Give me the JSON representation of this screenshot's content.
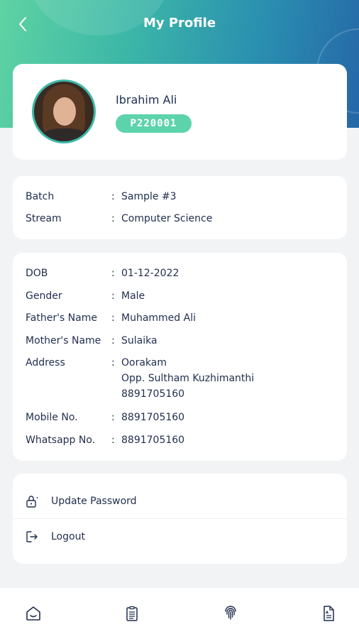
{
  "header": {
    "title": "My Profile"
  },
  "profile": {
    "name": "Ibrahim Ali",
    "id": "P220001"
  },
  "academic": [
    {
      "label": "Batch",
      "value": "Sample #3"
    },
    {
      "label": "Stream",
      "value": "Computer Science"
    }
  ],
  "personal": {
    "dob": {
      "label": "DOB",
      "value": "01-12-2022"
    },
    "gender": {
      "label": "Gender",
      "value": "Male"
    },
    "father": {
      "label": "Father's Name",
      "value": "Muhammed Ali"
    },
    "mother": {
      "label": "Mother's Name",
      "value": "Sulaika"
    },
    "address": {
      "label": "Address",
      "lines": [
        "Oorakam",
        "Opp. Sultham Kuzhimanthi",
        "8891705160"
      ]
    },
    "mobile": {
      "label": "Mobile No.",
      "value": "8891705160"
    },
    "whatsapp": {
      "label": "Whatsapp No.",
      "value": "8891705160"
    }
  },
  "separator": ":",
  "menu": {
    "update_password": "Update Password",
    "logout": "Logout"
  },
  "icons": {
    "back": "chevron-left-icon",
    "update_password": "lock-icon",
    "logout": "logout-icon",
    "nav": [
      "home-icon",
      "clipboard-icon",
      "fingerprint-icon",
      "document-icon"
    ]
  },
  "colors": {
    "accent": "#5dd3ab",
    "header_start": "#5fd3a3",
    "header_end": "#2567a8",
    "text": "#1f2d4d"
  }
}
